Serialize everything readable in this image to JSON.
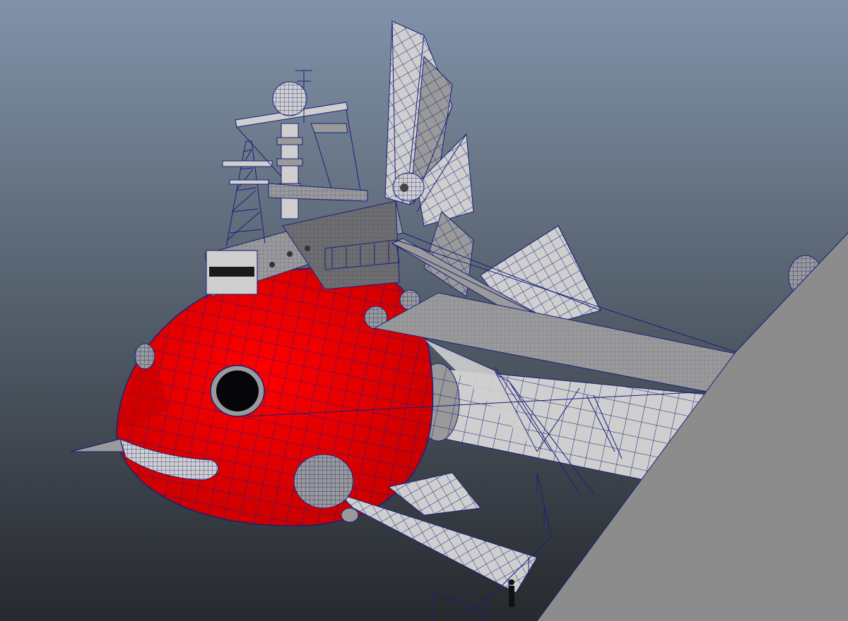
{
  "viewport": {
    "background_top": "#8193a9",
    "background_bottom": "#26292d"
  },
  "model": {
    "hull_color": "#ff0000",
    "hull_shadow_color": "#c40000",
    "wireframe_color": "#1a1f7a",
    "structure_color": "#9a9a9a",
    "structure_light_color": "#cfcfcf",
    "structure_dark_color": "#6e6e6e",
    "porthole_color": "#05050a"
  },
  "objects": [
    {
      "name": "hull"
    },
    {
      "name": "porthole"
    },
    {
      "name": "tower"
    },
    {
      "name": "radar-dome"
    },
    {
      "name": "lattice-mast"
    },
    {
      "name": "dorsal-fin"
    },
    {
      "name": "rear-fin"
    },
    {
      "name": "wing"
    },
    {
      "name": "tail-cylinder"
    },
    {
      "name": "lower-fin"
    },
    {
      "name": "dock-ramp"
    },
    {
      "name": "railing"
    }
  ]
}
